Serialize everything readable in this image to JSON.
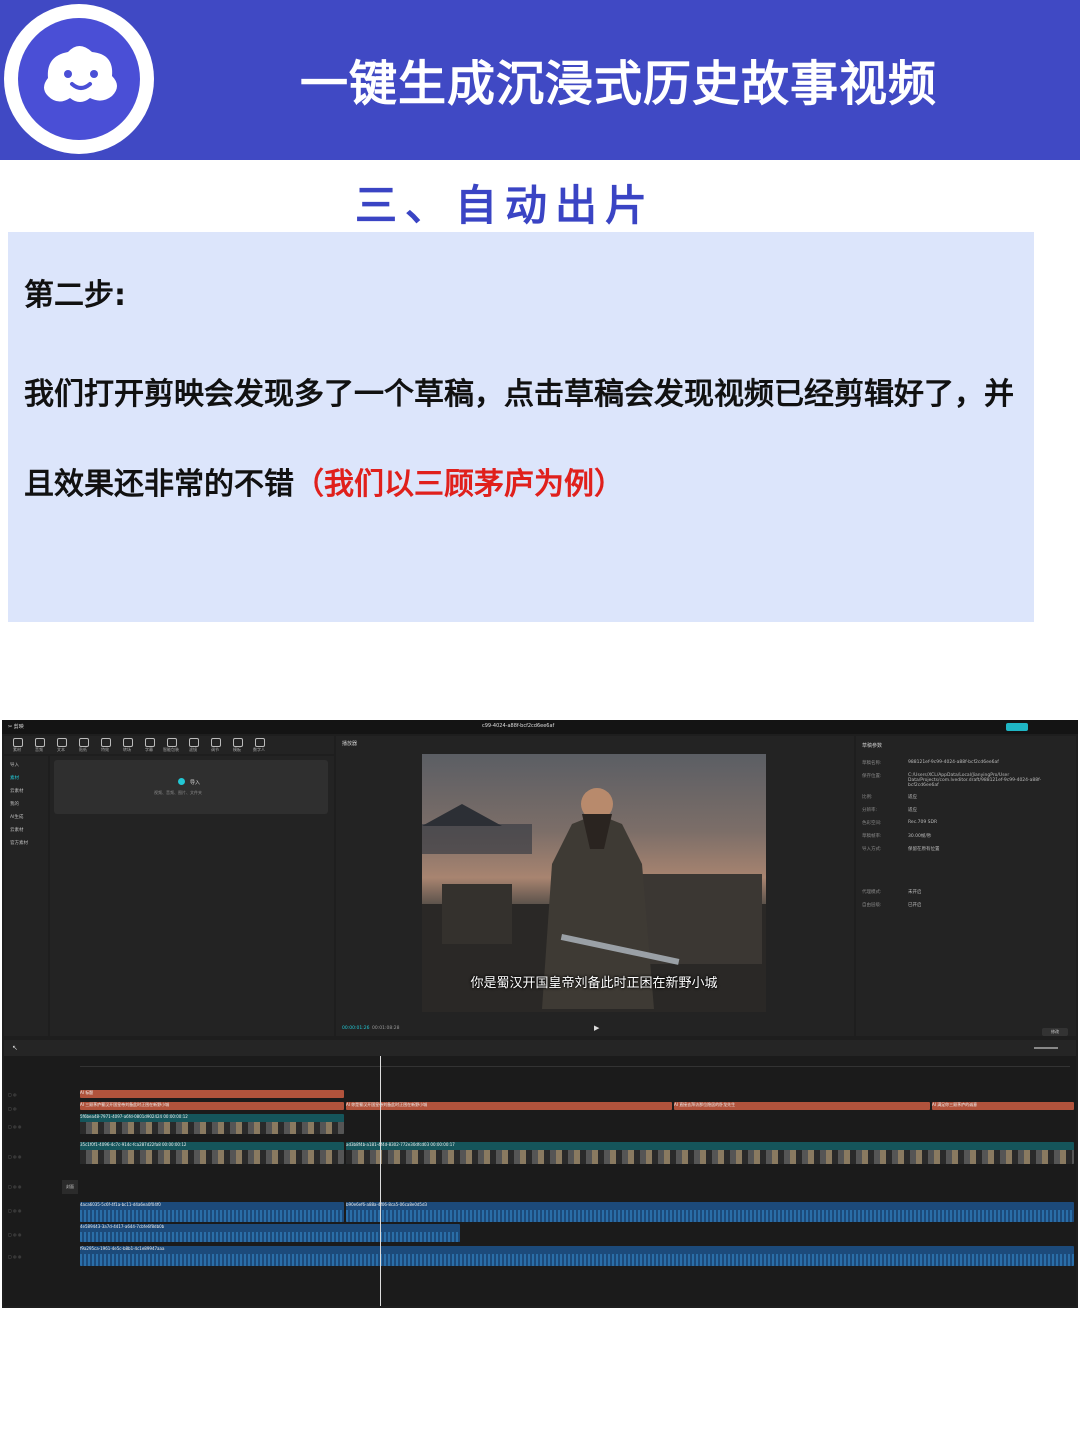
{
  "banner": {
    "title": "一键生成沉浸式历史故事视频",
    "logo_icon": "ghost-mascot-icon",
    "color": "#4049c4"
  },
  "section_title": "三、自动出片",
  "panel": {
    "step_label": "第二步:",
    "body_text": "我们打开剪映会发现多了一个草稿，点击草稿会发现视频已经剪辑好了，并且效果还非常的不错",
    "highlight": "（我们以三顾茅庐为例）",
    "highlight_color": "#e0201c",
    "background": "#dce5fb"
  },
  "app": {
    "window_title": "c99-4024-a88f-bcf2cd6ee6af",
    "toolbar": [
      "素材",
      "音频",
      "文本",
      "贴纸",
      "特效",
      "转场",
      "字幕",
      "智能包装",
      "滤镜",
      "调节",
      "模板",
      "数字人"
    ],
    "sidenav": [
      "导入",
      "素材",
      "云素材",
      "我的",
      "AI生成",
      "云素材",
      "官方素材"
    ],
    "import_label": "导入",
    "import_hint": "视频、音频、图片、文件夹",
    "preview_title": "播放器",
    "subtitle": "你是蜀汉开国皇帝刘备此时正困在新野小城",
    "time_current": "00:00:01:26",
    "time_total": "00:01:08:28",
    "props_title": "草稿参数",
    "props": [
      {
        "k": "草稿名称:",
        "v": "988121ef-9c99-4024-a88f-bcf2cd6ee6af"
      },
      {
        "k": "保存位置:",
        "v": "C:/Users/XCL/AppData/Local/JianyingPro/User Data/Projects/com.lveditor.draft/988121ef-9c99-4024-a88f-bcf2cd6ee6af"
      },
      {
        "k": "比例:",
        "v": "适应"
      },
      {
        "k": "分辨率:",
        "v": "适应"
      },
      {
        "k": "色彩空间:",
        "v": "Rec.709 SDR"
      },
      {
        "k": "草稿帧率:",
        "v": "30.00帧/秒"
      },
      {
        "k": "导入方式:",
        "v": "保留在原有位置"
      },
      {
        "k": "代理模式:",
        "v": "未开启"
      },
      {
        "k": "自由层级:",
        "v": "已开启"
      }
    ],
    "modify_button": "修改",
    "cover_label": "封面"
  },
  "tracks": {
    "text1": "AI 标题",
    "text2_a": "AI 三顾茅庐蜀汉开国皇帝刘备此时正困在新野小城",
    "text2_b": "AI 你是蜀汉开国皇帝刘备此时正困在新野小城",
    "text2_c": "AI 直接去拜访那位隐居的卧龙先生",
    "text2_d": "AI 满足你三顾茅庐的诚意",
    "video1": "5f6bea48-7971-4097-a6fd-0801d902424  00:00:00:12",
    "video2": "35c1f0f1-4096-4c7c-914c-fca287d22fa8  00:00:00:12",
    "video3": "ad3b8f4b-a181-4f4d-8302-772e30dfcd03  00:00:00:17",
    "audio1": "4aca6035-5c6f-4f1a-bc11-d4a6ea0f04f0",
    "audio2": "b90e6ef6-a88a-4f06-8ca5-06ca8e0d5d3",
    "audio3": "4e589443-3a7d-4417-a644-7cbfe6f8db0b",
    "audio4": "f9a295ca-1961-4e5c-b8b1-4c1e89947aaa"
  }
}
